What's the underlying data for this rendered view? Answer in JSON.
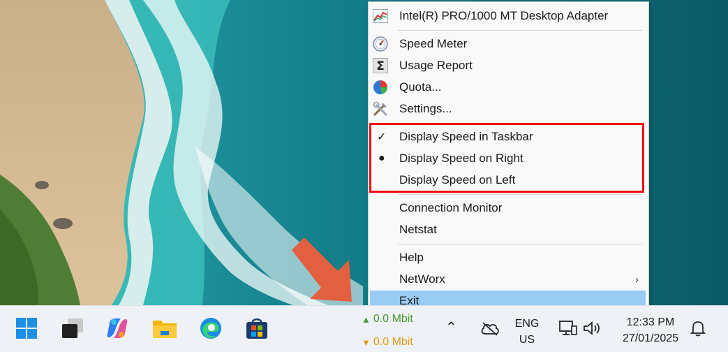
{
  "menu": {
    "adapter": "Intel(R) PRO/1000 MT Desktop Adapter",
    "speed_meter": "Speed Meter",
    "usage_report": "Usage Report",
    "quota": "Quota...",
    "settings": "Settings...",
    "display_taskbar": "Display Speed in Taskbar",
    "display_right": "Display Speed on Right",
    "display_left": "Display Speed on Left",
    "connection_monitor": "Connection Monitor",
    "netstat": "Netstat",
    "help": "Help",
    "networx": "NetWorx",
    "exit": "Exit"
  },
  "taskbar": {
    "upload_speed": "0.0 Mbit",
    "download_speed": "0.0 Mbit",
    "language_line1": "ENG",
    "language_line2": "US",
    "time": "12:33 PM",
    "date": "27/01/2025"
  },
  "colors": {
    "highlight": "#99ccf3",
    "annotation_red": "#ee1010",
    "upload_green": "#4a9b2a",
    "download_orange": "#e39a17",
    "arrow_annotation": "#e2603f"
  },
  "icons": {
    "adapter": "line-chart-icon",
    "speed_meter": "speedometer-icon",
    "usage_report": "sigma-icon",
    "quota": "pie-chart-icon",
    "settings": "tools-icon"
  }
}
